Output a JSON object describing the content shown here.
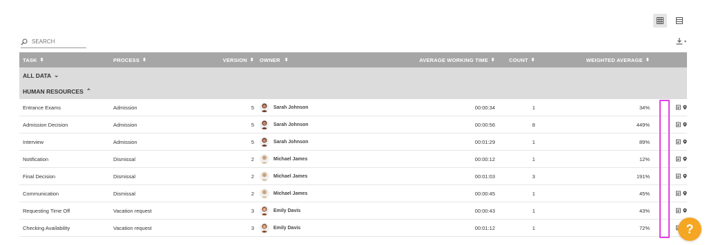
{
  "search": {
    "placeholder": "SEARCH"
  },
  "columns": {
    "task": "TASK",
    "process": "PROCESS",
    "version": "VERSION",
    "owner": "OWNER",
    "avg_time": "AVERAGE WORKING TIME",
    "count": "COUNT",
    "weighted": "WEIGHTED AVERAGE"
  },
  "groups": {
    "all": "ALL DATA",
    "hr": "HUMAN RESOURCES"
  },
  "rows": [
    {
      "task": "Entrance Exams",
      "process": "Admission",
      "version": "5",
      "owner": "Sarah Johnson",
      "time": "00:00:34",
      "count": "1",
      "weighted": "34%"
    },
    {
      "task": "Admission Decision",
      "process": "Admission",
      "version": "5",
      "owner": "Sarah Johnson",
      "time": "00:00:56",
      "count": "8",
      "weighted": "449%"
    },
    {
      "task": "Interview",
      "process": "Admission",
      "version": "5",
      "owner": "Sarah Johnson",
      "time": "00:01:29",
      "count": "1",
      "weighted": "89%"
    },
    {
      "task": "Notification",
      "process": "Dismissal",
      "version": "2",
      "owner": "Michael James",
      "time": "00:00:12",
      "count": "1",
      "weighted": "12%"
    },
    {
      "task": "Final Decision",
      "process": "Dismissal",
      "version": "2",
      "owner": "Michael James",
      "time": "00:01:03",
      "count": "3",
      "weighted": "191%"
    },
    {
      "task": "Communication",
      "process": "Dismissal",
      "version": "2",
      "owner": "Michael James",
      "time": "00:00:45",
      "count": "1",
      "weighted": "45%"
    },
    {
      "task": "Requesting Time Off",
      "process": "Vacation request",
      "version": "3",
      "owner": "Emily Davis",
      "time": "00:00:43",
      "count": "1",
      "weighted": "43%"
    },
    {
      "task": "Checking Availability",
      "process": "Vacation request",
      "version": "3",
      "owner": "Emily Davis",
      "time": "00:01:12",
      "count": "1",
      "weighted": "72%"
    }
  ],
  "help": {
    "label": "?"
  },
  "colors": {
    "header": "#a6a6a6",
    "group": "#dcdcdc",
    "highlight": "#e040e0",
    "help": "#f5a623"
  }
}
